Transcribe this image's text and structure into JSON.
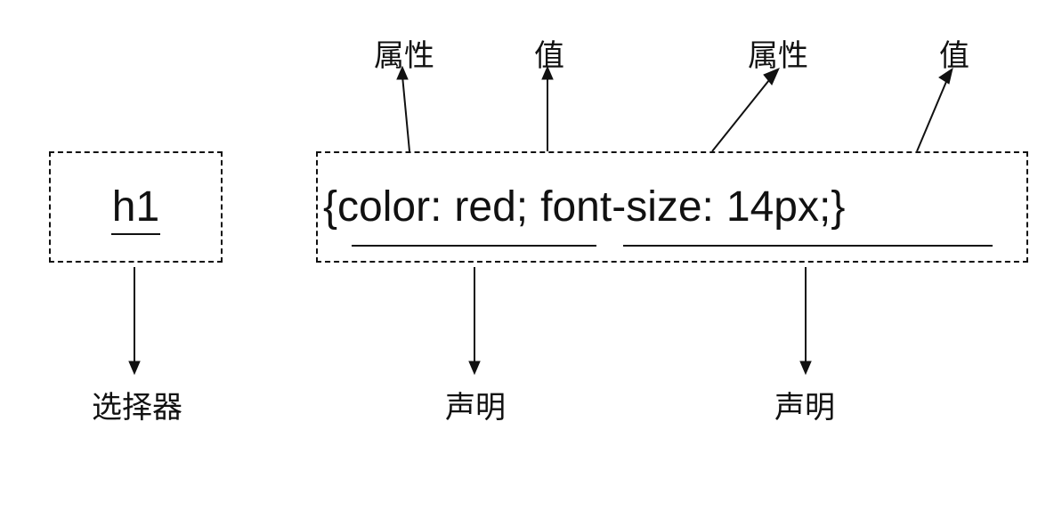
{
  "selector": {
    "text": "h1",
    "label": "选择器"
  },
  "declarations": {
    "open_brace": "{",
    "close_brace": "}",
    "items": [
      {
        "property": "color",
        "colon": ":",
        "value": "red",
        "semicolon": ";"
      },
      {
        "property": "font-size",
        "colon": ":",
        "value": "14px",
        "semicolon": ";"
      }
    ]
  },
  "labels": {
    "property": "属性",
    "value": "值",
    "declaration": "声明"
  }
}
